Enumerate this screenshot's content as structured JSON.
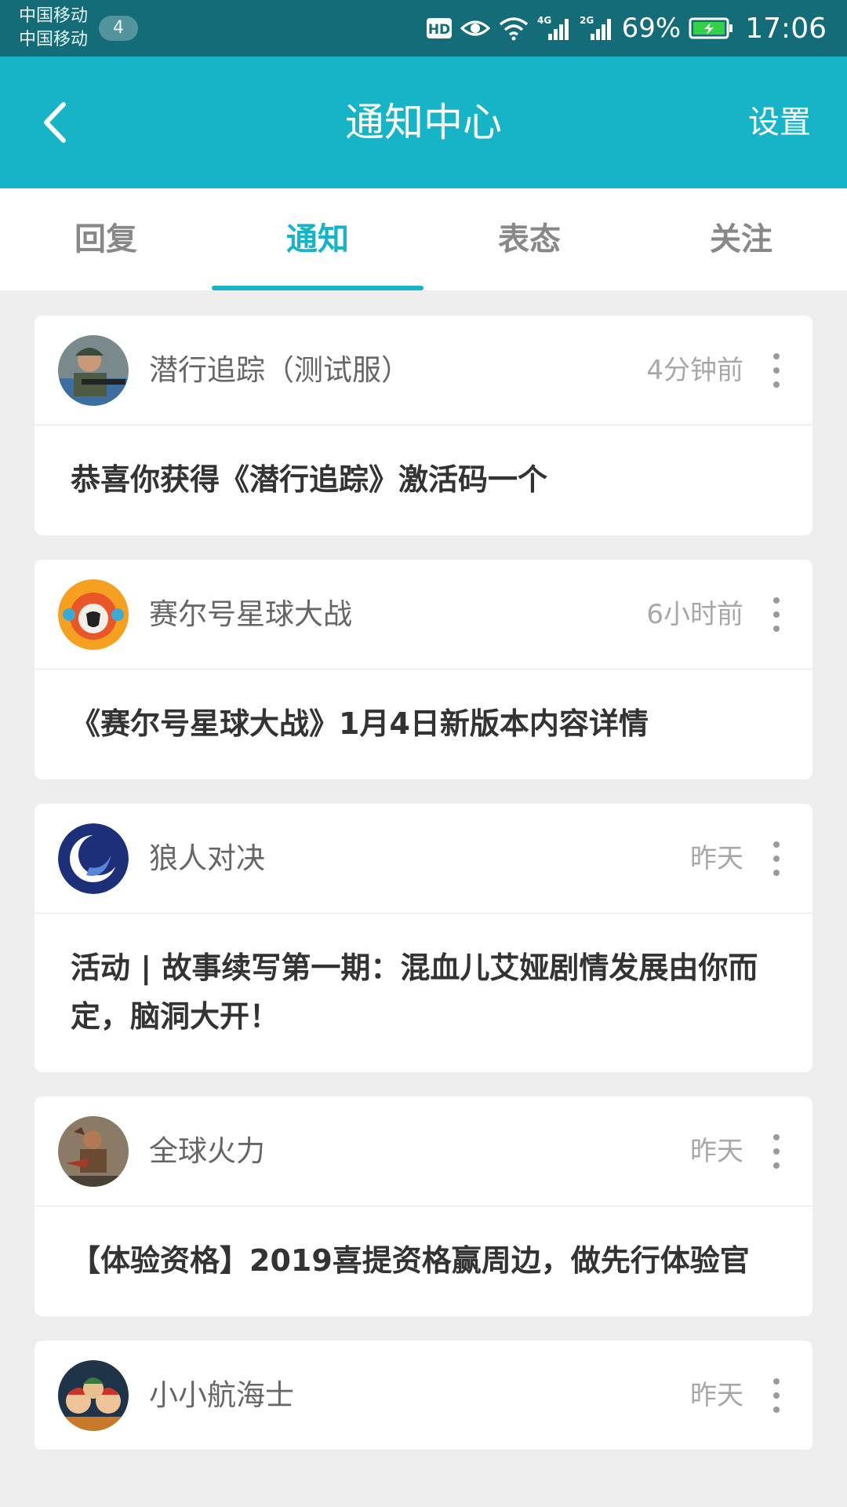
{
  "status_bar": {
    "carrier_1": "中国移动",
    "carrier_2": "中国移动",
    "sim_badge": "4",
    "hd_label": "HD",
    "net_1": "4G",
    "net_2": "2G",
    "battery": "69%",
    "time": "17:06"
  },
  "header": {
    "title": "通知中心",
    "settings_label": "设置"
  },
  "tabs": [
    {
      "label": "回复"
    },
    {
      "label": "通知"
    },
    {
      "label": "表态"
    },
    {
      "label": "关注"
    }
  ],
  "active_tab": "通知",
  "notifications": [
    {
      "app": "潜行追踪（测试服）",
      "time": "4分钟前",
      "message": "恭喜你获得《潜行追踪》激活码一个"
    },
    {
      "app": "赛尔号星球大战",
      "time": "6小时前",
      "message": "《赛尔号星球大战》1月4日新版本内容详情"
    },
    {
      "app": "狼人对决",
      "time": "昨天",
      "message": "活动 | 故事续写第一期：混血儿艾娅剧情发展由你而定，脑洞大开！"
    },
    {
      "app": "全球火力",
      "time": "昨天",
      "message": "【体验资格】2019喜提资格赢周边，做先行体验官"
    },
    {
      "app": "小小航海士",
      "time": "昨天",
      "message": ""
    }
  ],
  "colors": {
    "accent": "#16b4c6",
    "status_bar": "#136c78",
    "background": "#eeeeee"
  }
}
